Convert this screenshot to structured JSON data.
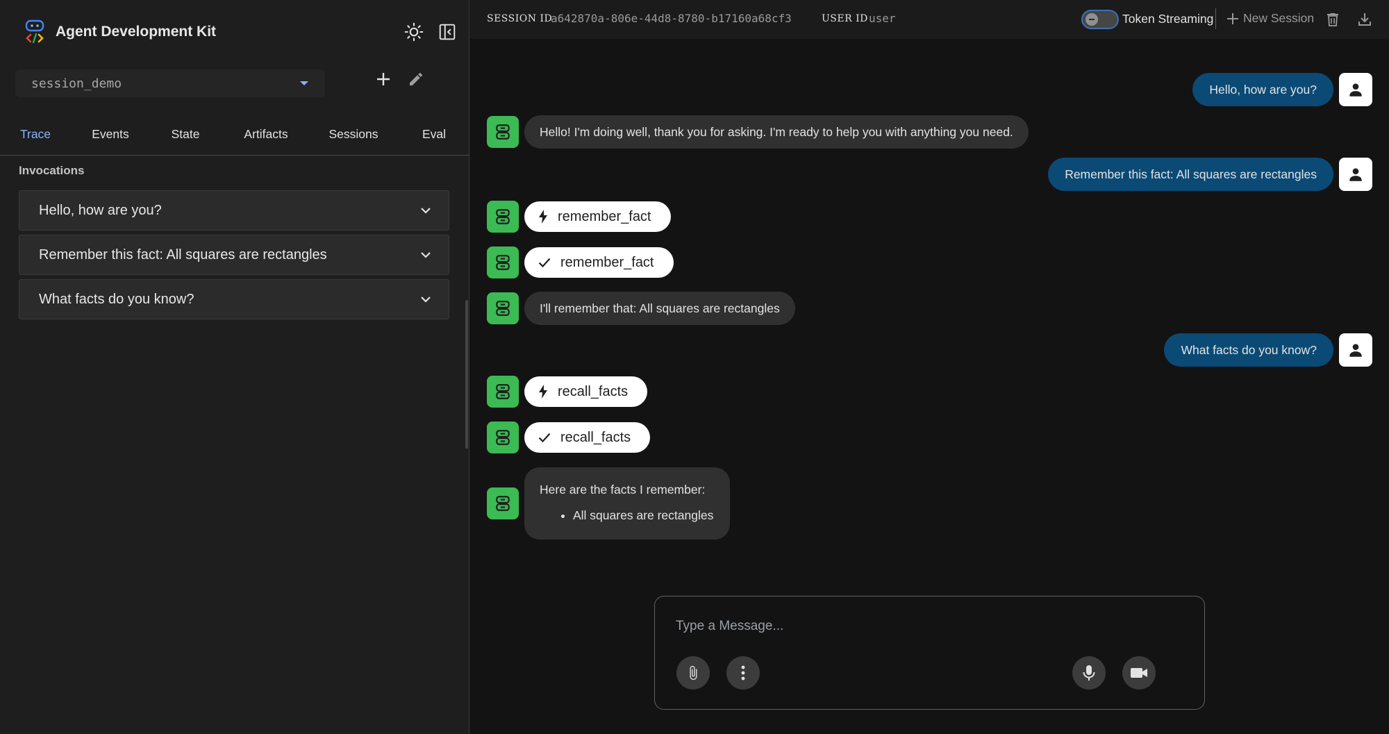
{
  "brand": {
    "title": "Agent Development Kit"
  },
  "sidebar": {
    "session_select": {
      "value": "session_demo"
    },
    "tabs": [
      {
        "label": "Trace"
      },
      {
        "label": "Events"
      },
      {
        "label": "State"
      },
      {
        "label": "Artifacts"
      },
      {
        "label": "Sessions"
      },
      {
        "label": "Eval"
      }
    ],
    "active_tab": "Trace",
    "invocations_title": "Invocations",
    "invocations": [
      {
        "label": "Hello, how are you?"
      },
      {
        "label": "Remember this fact: All squares are rectangles"
      },
      {
        "label": "What facts do you know?"
      }
    ]
  },
  "header": {
    "session_id_label": "SESSION ID",
    "session_id": "a642870a-806e-44d8-8780-b17160a68cf3",
    "user_id_label": "USER ID",
    "user_id": "user",
    "token_streaming_label": "Token Streaming",
    "token_streaming_enabled": false,
    "new_session_label": "New Session"
  },
  "chat": {
    "messages": [
      {
        "role": "user",
        "text": "Hello, how are you?"
      },
      {
        "role": "agent",
        "text": "Hello! I'm doing well, thank you for asking. I'm ready to help you with anything you need."
      },
      {
        "role": "user",
        "text": "Remember this fact: All squares are rectangles"
      },
      {
        "role": "agent-function-call",
        "icon": "bolt-icon",
        "text": "remember_fact"
      },
      {
        "role": "agent-function-response",
        "icon": "check-icon",
        "text": "remember_fact"
      },
      {
        "role": "agent",
        "text": "I'll remember that: All squares are rectangles"
      },
      {
        "role": "user",
        "text": "What facts do you know?"
      },
      {
        "role": "agent-function-call",
        "icon": "bolt-icon",
        "text": "recall_facts"
      },
      {
        "role": "agent-function-response",
        "icon": "check-icon",
        "text": "recall_facts"
      },
      {
        "role": "agent",
        "text": "Here are the facts I remember:",
        "bullets": [
          "All squares are rectangles"
        ]
      }
    ]
  },
  "composer": {
    "placeholder": "Type a Message..."
  },
  "colors": {
    "agent_avatar": "#3cba54",
    "user_bubble": "#0a4a75",
    "accent": "#8ab4f8",
    "background": "#131314"
  }
}
